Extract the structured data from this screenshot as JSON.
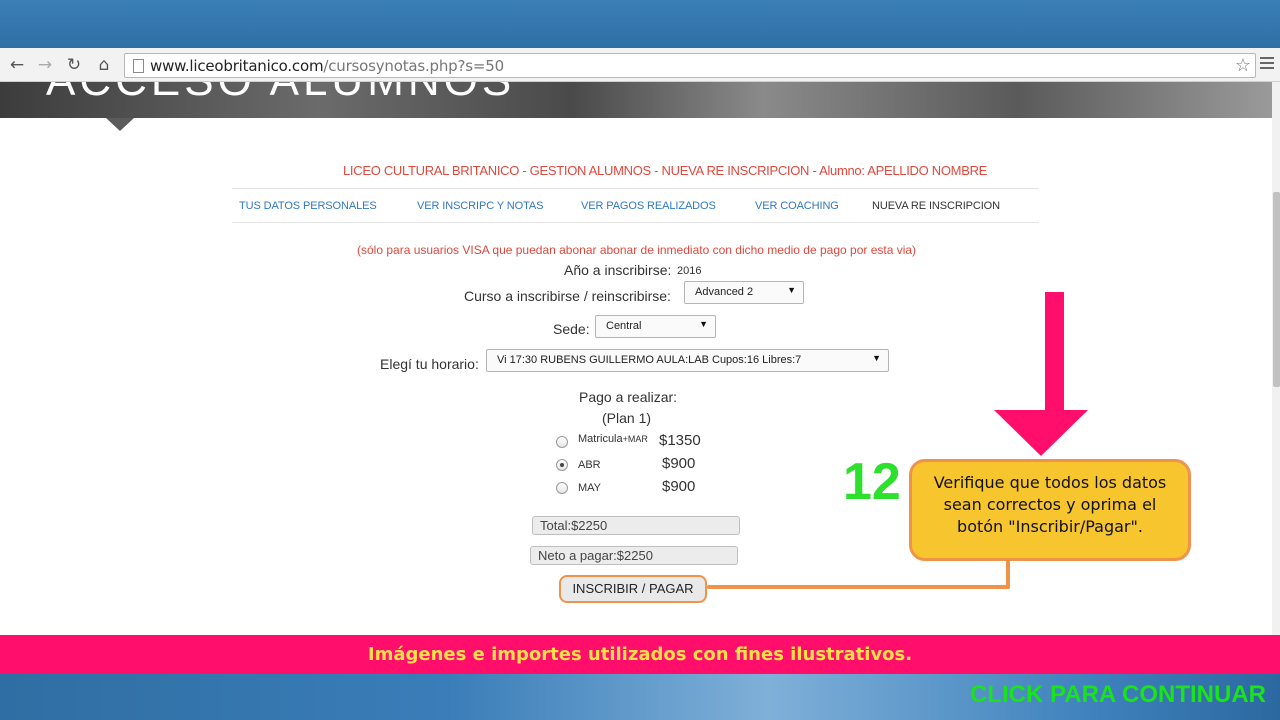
{
  "browser": {
    "url_domain": "www.liceobritanico.com",
    "url_path": "/cursosynotas.php?s=50"
  },
  "hero": {
    "text": "ACCESO ALUMNOS"
  },
  "page": {
    "header": "LICEO CULTURAL BRITANICO - GESTION ALUMNOS - NUEVA RE INSCRIPCION - Alumno: APELLIDO NOMBRE",
    "tabs": [
      {
        "label": "TUS DATOS PERSONALES"
      },
      {
        "label": "VER INSCRIPC Y NOTAS"
      },
      {
        "label": "VER PAGOS REALIZADOS"
      },
      {
        "label": "VER COACHING"
      },
      {
        "label": "NUEVA RE INSCRIPCION",
        "active": true
      }
    ],
    "visa_note": "(sólo para usuarios VISA que puedan abonar abonar de inmediato con dicho medio de pago por esta via)"
  },
  "form": {
    "year_label": "Año a inscribirse:",
    "year_value": "2016",
    "course_label": "Curso a inscribirse / reinscribirse:",
    "course_value": "Advanced 2",
    "branch_label": "Sede:",
    "branch_value": "Central",
    "schedule_label": "Elegí tu horario:",
    "schedule_value": "Vi 17:30 RUBENS GUILLERMO AULA:LAB Cupos:16 Libres:7",
    "payment_title": "Pago a realizar:",
    "plan": "(Plan  1)",
    "options": [
      {
        "label": "Matricula",
        "sub": "+MAR",
        "price": "$1350",
        "checked": false
      },
      {
        "label": "ABR",
        "price": "$900",
        "checked": true
      },
      {
        "label": "MAY",
        "price": "$900",
        "checked": false
      }
    ],
    "total": "Total:$2250",
    "net": "Neto a pagar:$2250",
    "submit_label": "INSCRIBIR / PAGAR"
  },
  "overlay": {
    "step_number": "12",
    "callout_text": "Verifique que todos los datos sean correctos y oprima el botón \"Inscribir/Pagar\".",
    "arrow_color": "#ff0f6b",
    "callout_color": "#f7c52e",
    "disclaimer": "Imágenes e importes utilizados con fines ilustrativos.",
    "continue_label": "CLICK PARA CONTINUAR"
  }
}
